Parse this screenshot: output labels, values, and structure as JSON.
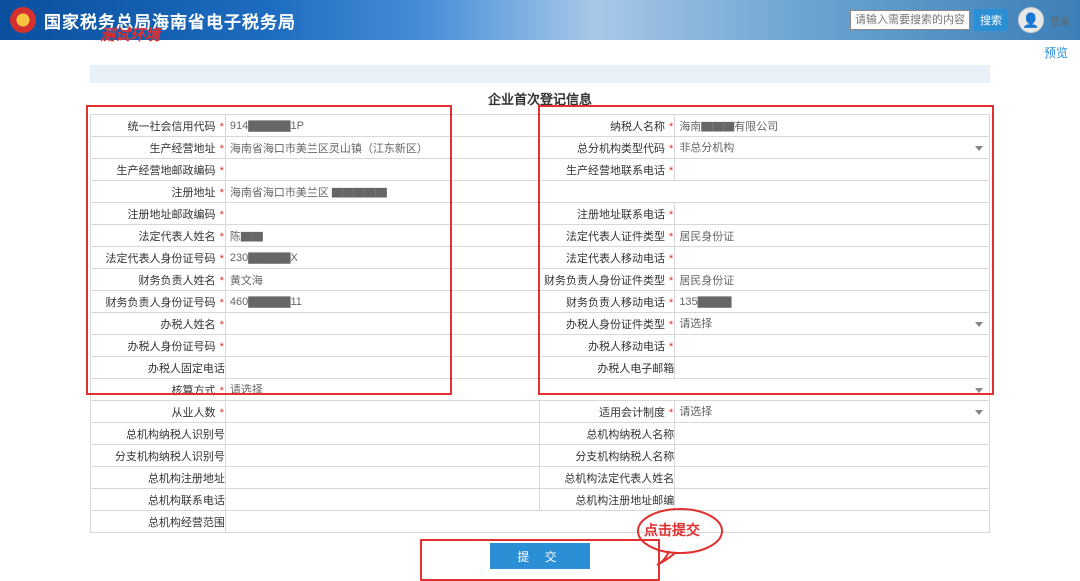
{
  "header": {
    "title": "国家税务总局海南省电子税务局",
    "test_env": "测试环境",
    "search_placeholder": "请输入需要搜索的内容",
    "search_button": "搜索",
    "login": "登录"
  },
  "subheader": {
    "preview": "预览"
  },
  "form": {
    "title": "企业首次登记信息",
    "rows": [
      [
        {
          "label": "统一社会信用代码",
          "req": true,
          "value": "914▇▇▇▇▇1P"
        },
        {
          "label": "纳税人名称",
          "req": true,
          "value": "海南▇▇▇有限公司"
        }
      ],
      [
        {
          "label": "生产经营地址",
          "req": true,
          "value": "海南省海口市美兰区灵山镇（江东新区）"
        },
        {
          "label": "总分机构类型代码",
          "req": true,
          "value": "非总分机构",
          "type": "select"
        }
      ],
      [
        {
          "label": "生产经营地邮政编码",
          "req": true,
          "value": ""
        },
        {
          "label": "生产经营地联系电话",
          "req": true,
          "value": ""
        }
      ],
      [
        {
          "label": "注册地址",
          "req": true,
          "value": "海南省海口市美兰区 ▇▇▇▇▇",
          "colspan": 3
        }
      ],
      [
        {
          "label": "注册地址邮政编码",
          "req": true,
          "value": ""
        },
        {
          "label": "注册地址联系电话",
          "req": true,
          "value": ""
        }
      ],
      [
        {
          "label": "法定代表人姓名",
          "req": true,
          "value": "陈▇▇"
        },
        {
          "label": "法定代表人证件类型",
          "req": true,
          "value": "居民身份证"
        }
      ],
      [
        {
          "label": "法定代表人身份证号码",
          "req": true,
          "value": "230▇▇▇▇▇X"
        },
        {
          "label": "法定代表人移动电话",
          "req": true,
          "value": ""
        }
      ],
      [
        {
          "label": "财务负责人姓名",
          "req": true,
          "value": "黄文海"
        },
        {
          "label": "财务负责人身份证件类型",
          "req": true,
          "value": "居民身份证"
        }
      ],
      [
        {
          "label": "财务负责人身份证号码",
          "req": true,
          "value": "460▇▇▇▇▇11"
        },
        {
          "label": "财务负责人移动电话",
          "req": true,
          "value": "135▇▇▇▇"
        }
      ],
      [
        {
          "label": "办税人姓名",
          "req": true,
          "value": ""
        },
        {
          "label": "办税人身份证件类型",
          "req": true,
          "placeholder": "请选择",
          "type": "select"
        }
      ],
      [
        {
          "label": "办税人身份证号码",
          "req": true,
          "value": ""
        },
        {
          "label": "办税人移动电话",
          "req": true,
          "value": ""
        }
      ],
      [
        {
          "label": "办税人固定电话",
          "req": false,
          "value": ""
        },
        {
          "label": "办税人电子邮箱",
          "req": false,
          "value": ""
        }
      ],
      [
        {
          "label": "核算方式",
          "req": true,
          "placeholder": "请选择",
          "type": "select",
          "colspan": 3
        }
      ],
      [
        {
          "label": "从业人数",
          "req": true,
          "value": ""
        },
        {
          "label": "适用会计制度",
          "req": true,
          "placeholder": "请选择",
          "type": "select"
        }
      ],
      [
        {
          "label": "总机构纳税人识别号",
          "req": false,
          "value": ""
        },
        {
          "label": "总机构纳税人名称",
          "req": false,
          "value": ""
        }
      ],
      [
        {
          "label": "分支机构纳税人识别号",
          "req": false,
          "value": ""
        },
        {
          "label": "分支机构纳税人名称",
          "req": false,
          "value": ""
        }
      ],
      [
        {
          "label": "总机构注册地址",
          "req": false,
          "value": ""
        },
        {
          "label": "总机构法定代表人姓名",
          "req": false,
          "value": ""
        }
      ],
      [
        {
          "label": "总机构联系电话",
          "req": false,
          "value": ""
        },
        {
          "label": "总机构注册地址邮编",
          "req": false,
          "value": ""
        }
      ],
      [
        {
          "label": "总机构经营范围",
          "req": false,
          "value": "",
          "colspan": 3
        }
      ]
    ],
    "submit": "提 交"
  },
  "annotations": {
    "click_submit": "点击提交"
  }
}
